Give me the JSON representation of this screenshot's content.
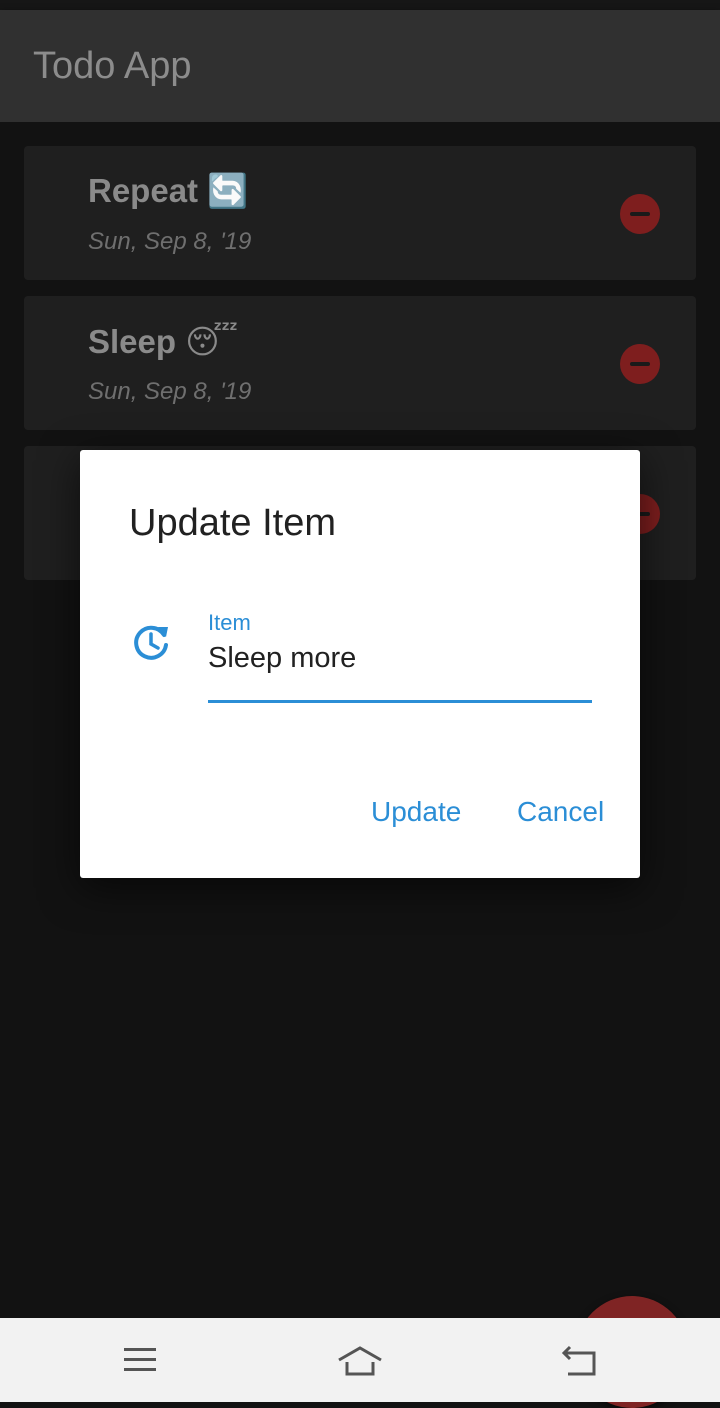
{
  "app_bar": {
    "title": "Todo App"
  },
  "todos": [
    {
      "title": "Repeat",
      "emoji": "🔄",
      "date": "Sun, Sep 8, '19"
    },
    {
      "title": "Sleep",
      "emoji": "😴",
      "date": "Sun, Sep 8, '19"
    }
  ],
  "dialog": {
    "title": "Update Item",
    "field_label": "Item",
    "field_value": "Sleep more",
    "update_label": "Update",
    "cancel_label": "Cancel"
  },
  "colors": {
    "accent": "#2b8ed6",
    "remove": "#7e1e1e",
    "fab": "#7f2424"
  },
  "icons": {
    "field": "history-icon",
    "fab": "plus-icon",
    "remove": "minus-circle-icon",
    "nav": [
      "menu-icon",
      "home-icon",
      "back-icon"
    ]
  }
}
